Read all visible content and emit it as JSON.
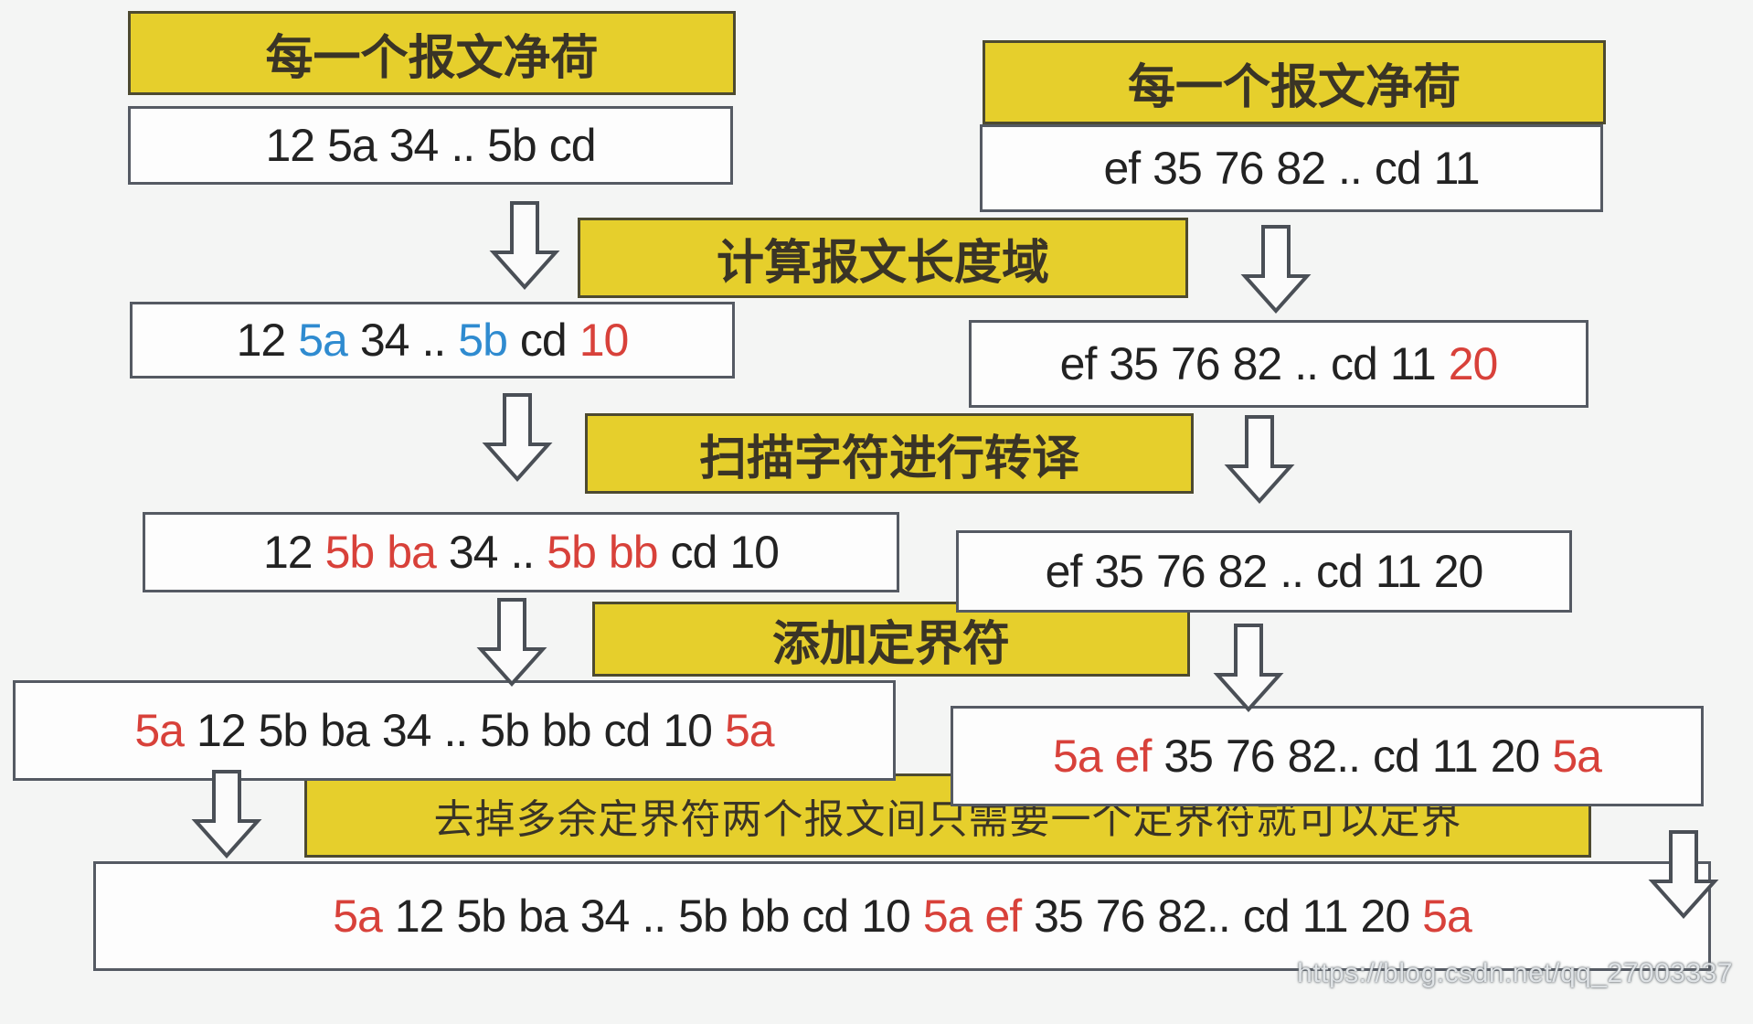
{
  "labels": {
    "payload_left": "每一个报文净荷",
    "payload_right": "每一个报文净荷",
    "step_length": "计算报文长度域",
    "step_escape": "扫描字符进行转译",
    "step_delim": "添加定界符",
    "step_merge": "去掉多余定界符两个报文间只需要一个定界符就可以定界"
  },
  "rows": {
    "l1": [
      {
        "t": "12",
        "c": "dark"
      },
      {
        "t": "5a",
        "c": "dark"
      },
      {
        "t": "34",
        "c": "dark"
      },
      {
        "t": "..",
        "c": "dark"
      },
      {
        "t": "5b",
        "c": "dark"
      },
      {
        "t": "cd",
        "c": "dark"
      }
    ],
    "r1": [
      {
        "t": "ef",
        "c": "dark"
      },
      {
        "t": "35",
        "c": "dark"
      },
      {
        "t": "76",
        "c": "dark"
      },
      {
        "t": "82",
        "c": "dark"
      },
      {
        "t": "..",
        "c": "dark"
      },
      {
        "t": "cd",
        "c": "dark"
      },
      {
        "t": "11",
        "c": "dark"
      }
    ],
    "l2": [
      {
        "t": "12",
        "c": "dark"
      },
      {
        "t": "5a",
        "c": "blue"
      },
      {
        "t": "34",
        "c": "dark"
      },
      {
        "t": "..",
        "c": "dark"
      },
      {
        "t": "5b",
        "c": "blue"
      },
      {
        "t": "cd",
        "c": "dark"
      },
      {
        "t": "10",
        "c": "red"
      }
    ],
    "r2": [
      {
        "t": "ef",
        "c": "dark"
      },
      {
        "t": "35",
        "c": "dark"
      },
      {
        "t": "76",
        "c": "dark"
      },
      {
        "t": "82",
        "c": "dark"
      },
      {
        "t": "..",
        "c": "dark"
      },
      {
        "t": "cd",
        "c": "dark"
      },
      {
        "t": "11",
        "c": "dark"
      },
      {
        "t": "20",
        "c": "red"
      }
    ],
    "l3": [
      {
        "t": "12",
        "c": "dark"
      },
      {
        "t": "5b",
        "c": "red"
      },
      {
        "t": "ba",
        "c": "red"
      },
      {
        "t": "34",
        "c": "dark"
      },
      {
        "t": "..",
        "c": "dark"
      },
      {
        "t": "5b",
        "c": "red"
      },
      {
        "t": "bb",
        "c": "red"
      },
      {
        "t": "cd",
        "c": "dark"
      },
      {
        "t": "10",
        "c": "dark"
      }
    ],
    "r3": [
      {
        "t": "ef",
        "c": "dark"
      },
      {
        "t": "35",
        "c": "dark"
      },
      {
        "t": "76",
        "c": "dark"
      },
      {
        "t": "82",
        "c": "dark"
      },
      {
        "t": "..",
        "c": "dark"
      },
      {
        "t": "cd",
        "c": "dark"
      },
      {
        "t": "11",
        "c": "dark"
      },
      {
        "t": "20",
        "c": "dark"
      }
    ],
    "l4": [
      {
        "t": "5a",
        "c": "red"
      },
      {
        "t": "12",
        "c": "dark"
      },
      {
        "t": "5b",
        "c": "dark"
      },
      {
        "t": "ba",
        "c": "dark"
      },
      {
        "t": "34",
        "c": "dark"
      },
      {
        "t": "..",
        "c": "dark"
      },
      {
        "t": "5b",
        "c": "dark"
      },
      {
        "t": "bb",
        "c": "dark"
      },
      {
        "t": "cd",
        "c": "dark"
      },
      {
        "t": "10",
        "c": "dark"
      },
      {
        "t": "5a",
        "c": "red"
      }
    ],
    "r4": [
      {
        "t": "5a",
        "c": "red"
      },
      {
        "t": "ef",
        "c": "red"
      },
      {
        "t": "35",
        "c": "dark"
      },
      {
        "t": "76",
        "c": "dark"
      },
      {
        "t": "82..",
        "c": "dark"
      },
      {
        "t": "cd",
        "c": "dark"
      },
      {
        "t": "11",
        "c": "dark"
      },
      {
        "t": "20",
        "c": "dark"
      },
      {
        "t": "5a",
        "c": "red"
      }
    ],
    "final": [
      {
        "t": "5a",
        "c": "red"
      },
      {
        "t": "12",
        "c": "dark"
      },
      {
        "t": "5b",
        "c": "dark"
      },
      {
        "t": "ba",
        "c": "dark"
      },
      {
        "t": "34",
        "c": "dark"
      },
      {
        "t": "..",
        "c": "dark"
      },
      {
        "t": "5b",
        "c": "dark"
      },
      {
        "t": "bb",
        "c": "dark"
      },
      {
        "t": "cd",
        "c": "dark"
      },
      {
        "t": "10",
        "c": "dark"
      },
      {
        "t": "5a",
        "c": "red"
      },
      {
        "t": "ef",
        "c": "red"
      },
      {
        "t": "35",
        "c": "dark"
      },
      {
        "t": "76",
        "c": "dark"
      },
      {
        "t": "82..",
        "c": "dark"
      },
      {
        "t": "cd",
        "c": "dark"
      },
      {
        "t": "11",
        "c": "dark"
      },
      {
        "t": "20",
        "c": "dark"
      },
      {
        "t": "5a",
        "c": "red"
      }
    ]
  },
  "watermark": "https://blog.csdn.net/qq_27003337",
  "colors": {
    "label_fill": "#e6cf2c",
    "highlight_red": "#d8413a",
    "highlight_blue": "#2f8bd0",
    "text_dark": "#222222"
  }
}
